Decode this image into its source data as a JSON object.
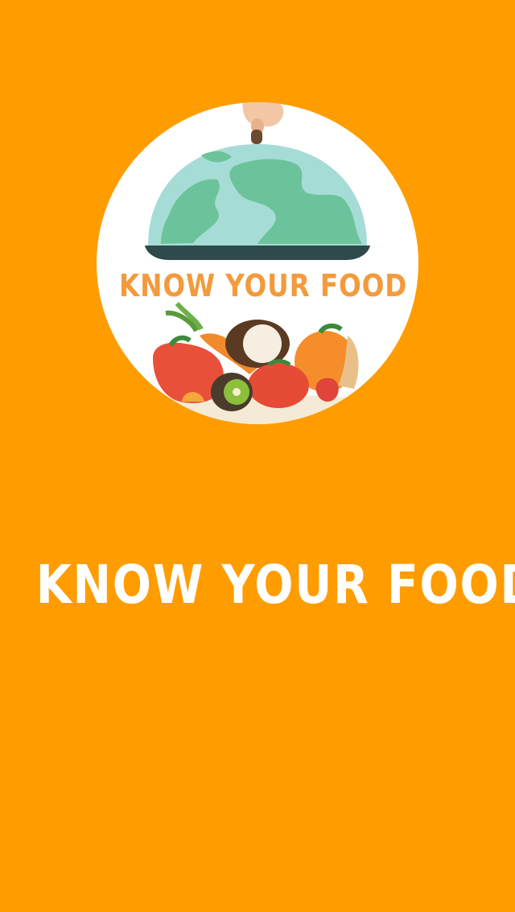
{
  "splash": {
    "logo_text": "KNOW YOUR FOOD",
    "title": "KNOW YOUR FOOD"
  },
  "colors": {
    "background": "#ff9c00",
    "title_text": "#ffffff",
    "logo_circle": "#ffffff",
    "logo_text": "#f39a3c",
    "globe_ocean": "#a6dcd6",
    "globe_land": "#6cc39b",
    "cloche_rim": "#2f4a4a"
  },
  "icons": {
    "logo": "globe-cloche-with-vegetables-icon"
  }
}
